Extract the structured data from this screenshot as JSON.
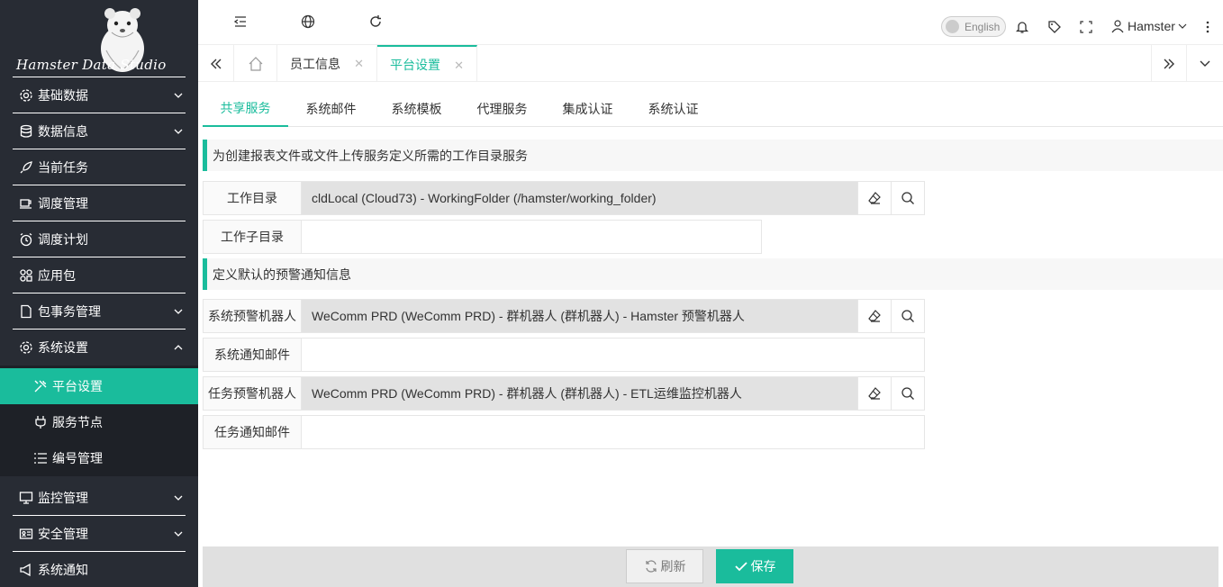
{
  "brand": {
    "name": "Hamster Data Studio"
  },
  "sidebar": {
    "items": [
      {
        "label": "基础数据",
        "icon": "gear-icon"
      },
      {
        "label": "数据信息",
        "icon": "database-icon"
      },
      {
        "label": "当前任务",
        "icon": "rocket-icon"
      },
      {
        "label": "调度管理",
        "icon": "coffee-icon"
      },
      {
        "label": "调度计划",
        "icon": "alarm-clock-icon"
      },
      {
        "label": "应用包",
        "icon": "apps-icon"
      },
      {
        "label": "包事务管理",
        "icon": "file-icon"
      },
      {
        "label": "系统设置",
        "icon": "gear-icon"
      }
    ],
    "sub_items": [
      {
        "label": "平台设置",
        "icon": "tools-icon"
      },
      {
        "label": "服务节点",
        "icon": "plug-icon"
      },
      {
        "label": "编号管理",
        "icon": "list-icon"
      }
    ],
    "bottom_items": [
      {
        "label": "监控管理",
        "icon": "monitor-icon"
      },
      {
        "label": "安全管理",
        "icon": "id-card-icon"
      },
      {
        "label": "系统通知",
        "icon": "megaphone-icon"
      }
    ]
  },
  "topbar": {
    "language": "English",
    "username": "Hamster"
  },
  "tabs": [
    {
      "label": "员工信息"
    },
    {
      "label": "平台设置"
    }
  ],
  "subtabs": [
    "共享服务",
    "系统邮件",
    "系统模板",
    "代理服务",
    "集成认证",
    "系统认证"
  ],
  "sections": {
    "workdir_title": "为创建报表文件或文件上传服务定义所需的工作目录服务",
    "alert_title": "定义默认的预警通知信息"
  },
  "form": {
    "workdir_label": "工作目录",
    "workdir_value": "cldLocal (Cloud73) - WorkingFolder (/hamster/working_folder)",
    "subdir_label": "工作子目录",
    "subdir_value": "",
    "sys_robot_label": "系统预警机器人",
    "sys_robot_value": "WeComm PRD (WeComm PRD) - 群机器人 (群机器人) - Hamster 预警机器人",
    "sys_mail_label": "系统通知邮件",
    "sys_mail_value": "",
    "task_robot_label": "任务预警机器人",
    "task_robot_value": "WeComm PRD (WeComm PRD) - 群机器人 (群机器人) - ETL运维监控机器人",
    "task_mail_label": "任务通知邮件",
    "task_mail_value": ""
  },
  "footer": {
    "refresh_label": "刷新",
    "save_label": "保存"
  },
  "colors": {
    "accent": "#1abc9c",
    "sidebar_bg": "#282c34"
  }
}
